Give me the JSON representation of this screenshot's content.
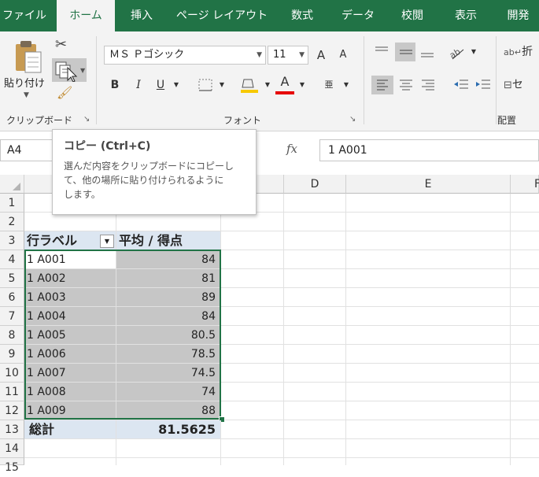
{
  "ribbon_tabs": [
    {
      "label": "ファイル",
      "active": false
    },
    {
      "label": "ホーム",
      "active": true
    },
    {
      "label": "挿入",
      "active": false
    },
    {
      "label": "ページ レイアウト",
      "active": false
    },
    {
      "label": "数式",
      "active": false
    },
    {
      "label": "データ",
      "active": false
    },
    {
      "label": "校閲",
      "active": false
    },
    {
      "label": "表示",
      "active": false
    },
    {
      "label": "開発",
      "active": false
    }
  ],
  "clipboard": {
    "paste_label": "貼り付け",
    "group_label": "クリップボード"
  },
  "font": {
    "name": "ＭＳ Ｐゴシック",
    "size": "11",
    "group_label": "フォント",
    "bold": "B",
    "italic": "I",
    "underline": "U",
    "grow": "A",
    "shrink": "A",
    "font_color": "A",
    "phonetic": "亜"
  },
  "alignment": {
    "group_label": "配置",
    "wrap_label": "折",
    "merge_label": "セ"
  },
  "name_box": "A4",
  "fx_label": "fx",
  "formula_value": "1 A001",
  "tooltip": {
    "title": "コピー (Ctrl+C)",
    "lines": [
      "選んだ内容をクリップボードにコピーし",
      "て、他の場所に貼り付けられるように",
      "します。"
    ]
  },
  "columns": [
    "D",
    "E"
  ],
  "partial_column": "F",
  "rows": [
    "1",
    "2",
    "3",
    "4",
    "5",
    "6",
    "7",
    "8",
    "9",
    "10",
    "11",
    "12",
    "13",
    "14",
    "15"
  ],
  "pivot": {
    "header_label": "行ラベル",
    "header_value": "平均 / 得点",
    "items": [
      {
        "label": "1 A001",
        "value": "84"
      },
      {
        "label": "1 A002",
        "value": "81"
      },
      {
        "label": "1 A003",
        "value": "89"
      },
      {
        "label": "1 A004",
        "value": "84"
      },
      {
        "label": "1 A005",
        "value": "80.5"
      },
      {
        "label": "1 A006",
        "value": "78.5"
      },
      {
        "label": "1 A007",
        "value": "74.5"
      },
      {
        "label": "1 A008",
        "value": "74"
      },
      {
        "label": "1 A009",
        "value": "88"
      }
    ],
    "total_label": "総計",
    "total_value": "81.5625"
  },
  "colors": {
    "accent": "#217346",
    "selection": "#c6c6c6",
    "pivot_header": "#dce6f1"
  }
}
